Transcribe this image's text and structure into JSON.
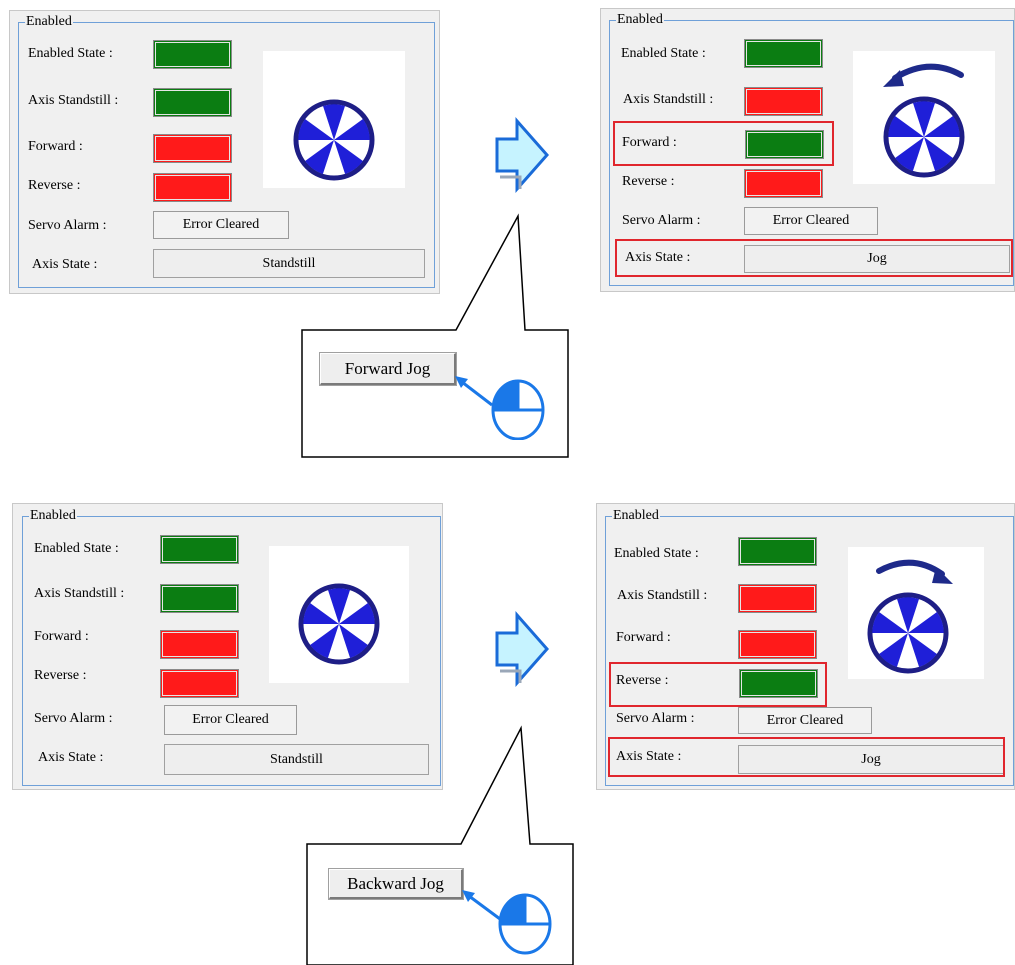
{
  "colors": {
    "on": "#0b7d12",
    "off": "#ff1a1a",
    "wheel": "#1f1fd8",
    "wheel_rim": "#1e1e86",
    "highlight": "#e0262d",
    "arrow_fill": "#c6f3ff",
    "arrow_stroke": "#1a6bd8"
  },
  "panels": [
    {
      "legend": "Enabled",
      "labels": {
        "enabled_state": "Enabled State :",
        "axis_standstill": "Axis Standstill :",
        "forward": "Forward :",
        "reverse": "Reverse :",
        "servo_alarm": "Servo Alarm :",
        "axis_state": "Axis State :"
      },
      "indicators": {
        "enabled_state": "on",
        "axis_standstill": "on",
        "forward": "off",
        "reverse": "off"
      },
      "servo_alarm_value": "Error Cleared",
      "axis_state_value": "Standstill",
      "rotation_icon": "none"
    },
    {
      "legend": "Enabled",
      "labels": {
        "enabled_state": "Enabled State :",
        "axis_standstill": "Axis Standstill :",
        "forward": "Forward :",
        "reverse": "Reverse :",
        "servo_alarm": "Servo Alarm :",
        "axis_state": "Axis State :"
      },
      "indicators": {
        "enabled_state": "on",
        "axis_standstill": "off",
        "forward": "on",
        "reverse": "off"
      },
      "servo_alarm_value": "Error Cleared",
      "axis_state_value": "Jog",
      "rotation_icon": "counterclockwise-arrow-icon"
    },
    {
      "legend": "Enabled",
      "labels": {
        "enabled_state": "Enabled State :",
        "axis_standstill": "Axis Standstill :",
        "forward": "Forward :",
        "reverse": "Reverse :",
        "servo_alarm": "Servo Alarm :",
        "axis_state": "Axis State :"
      },
      "indicators": {
        "enabled_state": "on",
        "axis_standstill": "on",
        "forward": "off",
        "reverse": "off"
      },
      "servo_alarm_value": "Error Cleared",
      "axis_state_value": "Standstill",
      "rotation_icon": "none"
    },
    {
      "legend": "Enabled",
      "labels": {
        "enabled_state": "Enabled State :",
        "axis_standstill": "Axis Standstill :",
        "forward": "Forward :",
        "reverse": "Reverse :",
        "servo_alarm": "Servo Alarm :",
        "axis_state": "Axis State :"
      },
      "indicators": {
        "enabled_state": "on",
        "axis_standstill": "off",
        "forward": "off",
        "reverse": "on"
      },
      "servo_alarm_value": "Error Cleared",
      "axis_state_value": "Jog",
      "rotation_icon": "clockwise-arrow-icon"
    }
  ],
  "callouts": [
    {
      "button_label": "Forward Jog",
      "icon": "mouse-click-icon"
    },
    {
      "button_label": "Backward Jog",
      "icon": "mouse-click-icon"
    }
  ]
}
